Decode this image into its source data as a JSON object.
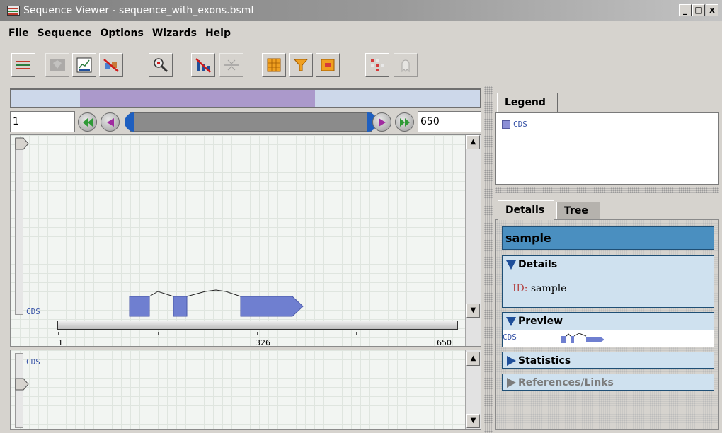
{
  "window": {
    "title": "Sequence Viewer - sequence_with_exons.bsml",
    "buttons": [
      "_",
      "□",
      "x"
    ]
  },
  "menu": [
    "File",
    "Sequence",
    "Options",
    "Wizards",
    "Help"
  ],
  "toolbar": {
    "icons": [
      "tracks-icon",
      "shape-icon",
      "chart-icon",
      "no-link-icon",
      "zoom-icon",
      "no-bars-icon",
      "align-icon",
      "grid-icon",
      "funnel-icon",
      "matrix-icon",
      "table-icon",
      "ghost-icon"
    ]
  },
  "navigation": {
    "start": "1",
    "end": "650"
  },
  "track": {
    "label": "CDS",
    "ticks": [
      "1",
      "326",
      "650"
    ],
    "label2": "CDS"
  },
  "legend": {
    "tab": "Legend",
    "items": [
      "CDS"
    ],
    "swatch_color": "#8c8fd6"
  },
  "details_panel": {
    "tabs": [
      "Details",
      "Tree"
    ],
    "header": "sample",
    "details": {
      "title": "Details",
      "id_key": "ID:",
      "id_value": "sample"
    },
    "preview": {
      "title": "Preview",
      "label": "CDS"
    },
    "statistics": {
      "title": "Statistics"
    },
    "references": {
      "title": "References/Links"
    }
  },
  "colors": {
    "cds": "#6f7fd0",
    "accent": "#4a8fc0"
  }
}
